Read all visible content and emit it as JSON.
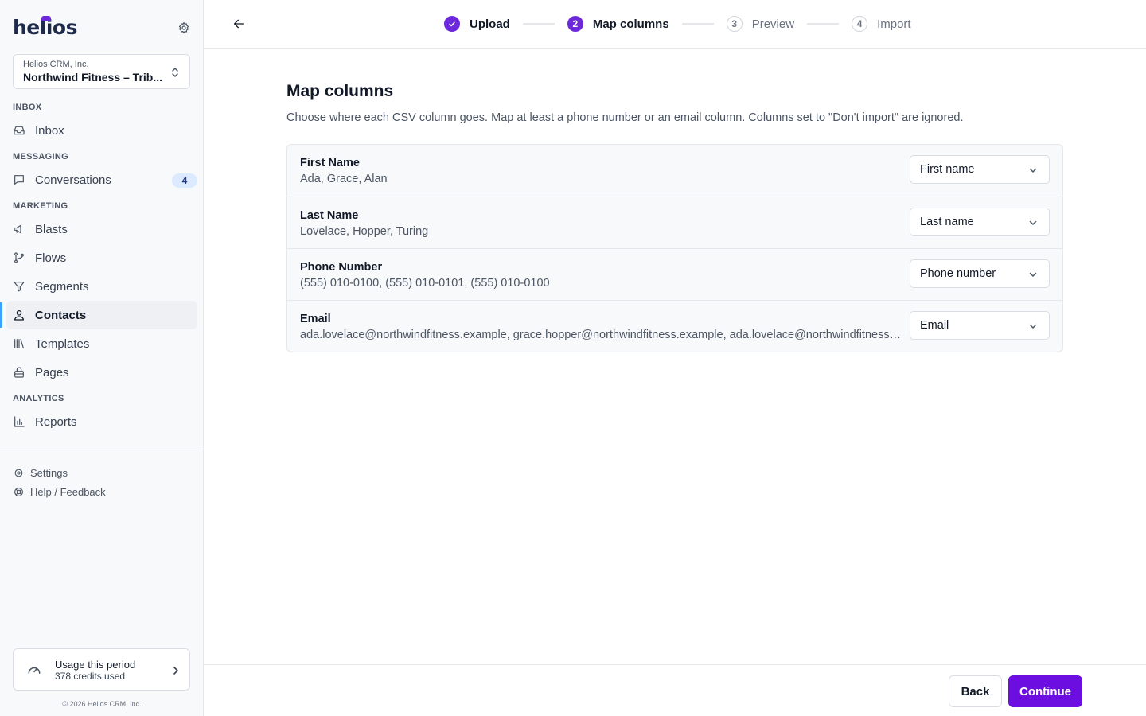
{
  "brand": {
    "logo_text": "helios"
  },
  "org": {
    "company": "Helios CRM, Inc.",
    "name": "Northwind Fitness – Trib..."
  },
  "nav": {
    "sections": [
      {
        "label": "INBOX"
      },
      {
        "label": "MESSAGING"
      },
      {
        "label": "MARKETING"
      },
      {
        "label": "ANALYTICS"
      }
    ],
    "items": {
      "inbox": "Inbox",
      "conversations": "Conversations",
      "conversations_badge": "4",
      "blasts": "Blasts",
      "flows": "Flows",
      "segments": "Segments",
      "contacts": "Contacts",
      "templates": "Templates",
      "pages": "Pages",
      "reports": "Reports"
    },
    "active": "contacts"
  },
  "footer": {
    "settings": "Settings",
    "help": "Help / Feedback",
    "usage_title": "Usage this period",
    "usage_sub": "378 credits used",
    "copyright": "© 2026 Helios CRM, Inc."
  },
  "stepper": {
    "steps": [
      {
        "number": "",
        "label": "Upload",
        "state": "done"
      },
      {
        "number": "2",
        "label": "Map columns",
        "state": "current"
      },
      {
        "number": "3",
        "label": "Preview",
        "state": "todo"
      },
      {
        "number": "4",
        "label": "Import",
        "state": "todo"
      }
    ]
  },
  "main": {
    "title": "Map columns",
    "description": "Choose where each CSV column goes. Map at least a phone number or an email column. Columns set to \"Don't import\" are ignored.",
    "rows": [
      {
        "column": "First Name",
        "samples": "Ada, Grace, Alan",
        "mapping": "First name"
      },
      {
        "column": "Last Name",
        "samples": "Lovelace, Hopper, Turing",
        "mapping": "Last name"
      },
      {
        "column": "Phone Number",
        "samples": "(555) 010-0100, (555) 010-0101, (555) 010-0100",
        "mapping": "Phone number"
      },
      {
        "column": "Email",
        "samples": "ada.lovelace@northwindfitness.example, grace.hopper@northwindfitness.example, ada.lovelace@northwindfitness.example",
        "mapping": "Email"
      }
    ]
  },
  "actions": {
    "back": "Back",
    "continue": "Continue"
  },
  "colors": {
    "accent": "#6d28d9",
    "active_indicator": "#3aa3ff",
    "badge_bg": "#dbeafe"
  }
}
